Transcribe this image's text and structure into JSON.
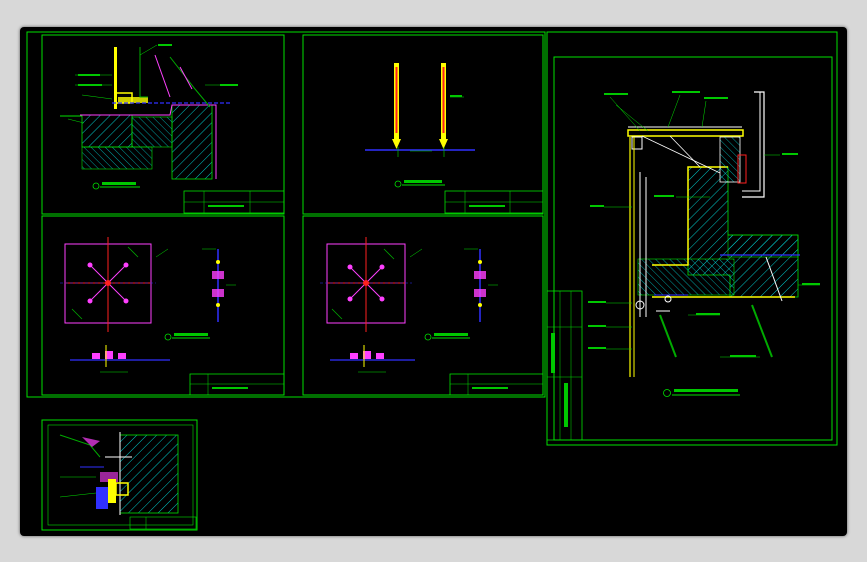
{
  "colors": {
    "background": "#000000",
    "outer": "#d8d8d8",
    "frame_line": "#00e000",
    "concrete_hatch": "#00c8c8",
    "steel": "#ffff00",
    "glass": "#00aa00",
    "fitting": "#ff40ff",
    "dim_line": "#3030ff",
    "red": "#ff2020",
    "white": "#ffffff"
  },
  "icons": [
    "drawing-sheet-icon",
    "hatch-pattern-icon",
    "spider-fitting-icon"
  ]
}
